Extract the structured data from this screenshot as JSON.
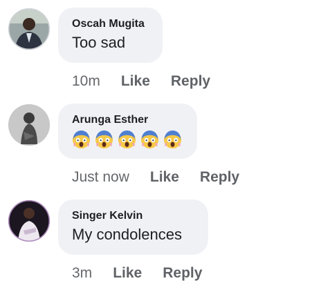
{
  "comments": [
    {
      "author": "Oscah Mugita",
      "text": "Too sad",
      "time": "10m",
      "like_label": "Like",
      "reply_label": "Reply",
      "avatar_icon": "profile-photo"
    },
    {
      "author": "Arunga Esther",
      "emojis": [
        "face-screaming-in-fear",
        "face-screaming-in-fear",
        "face-screaming-in-fear",
        "face-screaming-in-fear",
        "face-screaming-in-fear"
      ],
      "time": "Just now",
      "like_label": "Like",
      "reply_label": "Reply",
      "avatar_icon": "profile-photo"
    },
    {
      "author": "Singer Kelvin",
      "text": "My condolences",
      "time": "3m",
      "like_label": "Like",
      "reply_label": "Reply",
      "avatar_icon": "profile-photo"
    }
  ],
  "colors": {
    "bubble": "#f0f1f5",
    "name_text": "#1c1e21",
    "meta_text": "#65676b"
  }
}
